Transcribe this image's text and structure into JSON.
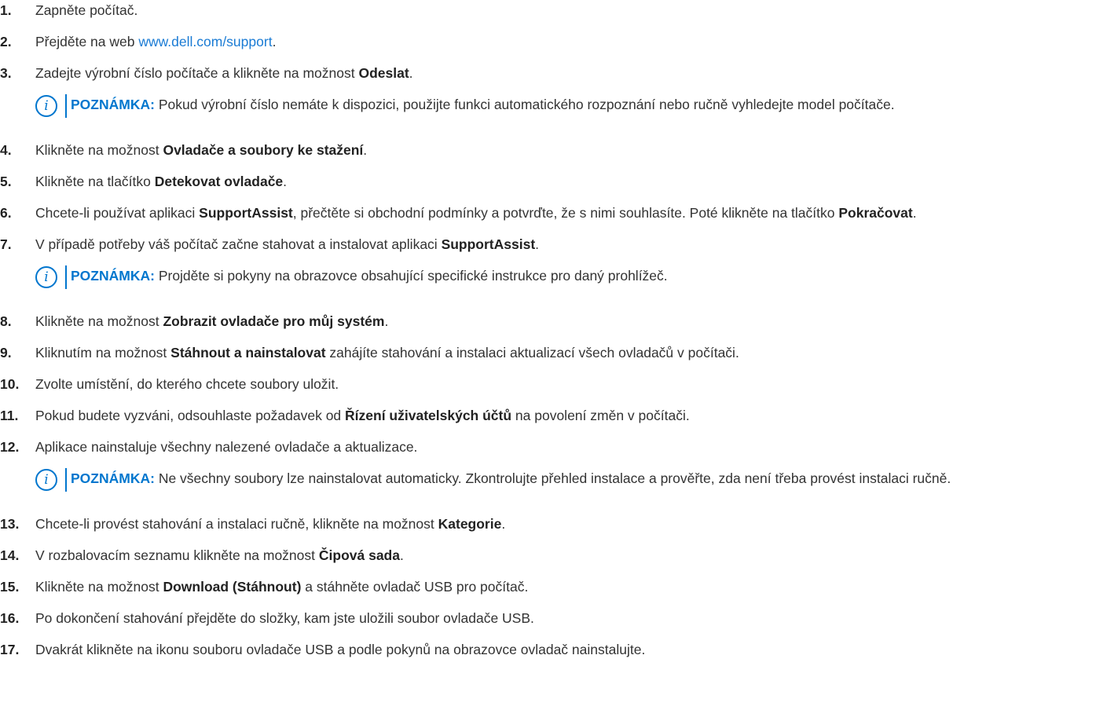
{
  "steps": [
    {
      "num": "1.",
      "parts": [
        {
          "t": "Zapněte počítač."
        }
      ]
    },
    {
      "num": "2.",
      "parts": [
        {
          "t": "Přejděte na web "
        },
        {
          "t": "www.dell.com/support",
          "link": true
        },
        {
          "t": "."
        }
      ]
    },
    {
      "num": "3.",
      "parts": [
        {
          "t": "Zadejte výrobní číslo počítače a klikněte na možnost "
        },
        {
          "t": "Odeslat",
          "b": true
        },
        {
          "t": "."
        }
      ],
      "note": "Pokud výrobní číslo nemáte k dispozici, použijte funkci automatického rozpoznání nebo ručně vyhledejte model počítače."
    },
    {
      "num": "4.",
      "parts": [
        {
          "t": "Klikněte na možnost "
        },
        {
          "t": "Ovladače a soubory ke stažení",
          "b": true
        },
        {
          "t": "."
        }
      ]
    },
    {
      "num": "5.",
      "parts": [
        {
          "t": "Klikněte na tlačítko "
        },
        {
          "t": "Detekovat ovladače",
          "b": true
        },
        {
          "t": "."
        }
      ]
    },
    {
      "num": "6.",
      "parts": [
        {
          "t": "Chcete-li používat aplikaci "
        },
        {
          "t": "SupportAssist",
          "b": true
        },
        {
          "t": ", přečtěte si obchodní podmínky a potvrďte, že s nimi souhlasíte. Poté klikněte na tlačítko "
        },
        {
          "t": "Pokračovat",
          "b": true
        },
        {
          "t": "."
        }
      ]
    },
    {
      "num": "7.",
      "parts": [
        {
          "t": "V případě potřeby váš počítač začne stahovat a instalovat aplikaci "
        },
        {
          "t": "SupportAssist",
          "b": true
        },
        {
          "t": "."
        }
      ],
      "note": "Projděte si pokyny na obrazovce obsahující specifické instrukce pro daný prohlížeč."
    },
    {
      "num": "8.",
      "parts": [
        {
          "t": "Klikněte na možnost "
        },
        {
          "t": "Zobrazit ovladače pro můj systém",
          "b": true
        },
        {
          "t": "."
        }
      ]
    },
    {
      "num": "9.",
      "parts": [
        {
          "t": "Kliknutím na možnost "
        },
        {
          "t": "Stáhnout a nainstalovat",
          "b": true
        },
        {
          "t": " zahájíte stahování a instalaci aktualizací všech ovladačů v počítači."
        }
      ]
    },
    {
      "num": "10.",
      "parts": [
        {
          "t": "Zvolte umístění, do kterého chcete soubory uložit."
        }
      ]
    },
    {
      "num": "11.",
      "parts": [
        {
          "t": "Pokud budete vyzváni, odsouhlaste požadavek od "
        },
        {
          "t": "Řízení uživatelských účtů",
          "b": true
        },
        {
          "t": " na povolení změn v počítači."
        }
      ]
    },
    {
      "num": "12.",
      "parts": [
        {
          "t": "Aplikace nainstaluje všechny nalezené ovladače a aktualizace."
        }
      ],
      "note": "Ne všechny soubory lze nainstalovat automaticky. Zkontrolujte přehled instalace a prověřte, zda není třeba provést instalaci ručně."
    },
    {
      "num": "13.",
      "parts": [
        {
          "t": "Chcete-li provést stahování a instalaci ručně, klikněte na možnost "
        },
        {
          "t": "Kategorie",
          "b": true
        },
        {
          "t": "."
        }
      ]
    },
    {
      "num": "14.",
      "parts": [
        {
          "t": "V rozbalovacím seznamu klikněte na možnost "
        },
        {
          "t": "Čipová sada",
          "b": true
        },
        {
          "t": "."
        }
      ]
    },
    {
      "num": "15.",
      "parts": [
        {
          "t": "Klikněte na možnost "
        },
        {
          "t": "Download (Stáhnout)",
          "b": true
        },
        {
          "t": " a stáhněte ovladač USB pro počítač."
        }
      ]
    },
    {
      "num": "16.",
      "parts": [
        {
          "t": "Po dokončení stahování přejděte do složky, kam jste uložili soubor ovladače USB."
        }
      ]
    },
    {
      "num": "17.",
      "parts": [
        {
          "t": "Dvakrát klikněte na ikonu souboru ovladače USB a podle pokynů na obrazovce ovladač nainstalujte."
        }
      ]
    }
  ],
  "note_label": "POZNÁMKA:",
  "note_icon": "info-circle-icon",
  "colors": {
    "accent": "#0076ce",
    "link": "#1a7bd4",
    "text": "#333333"
  }
}
